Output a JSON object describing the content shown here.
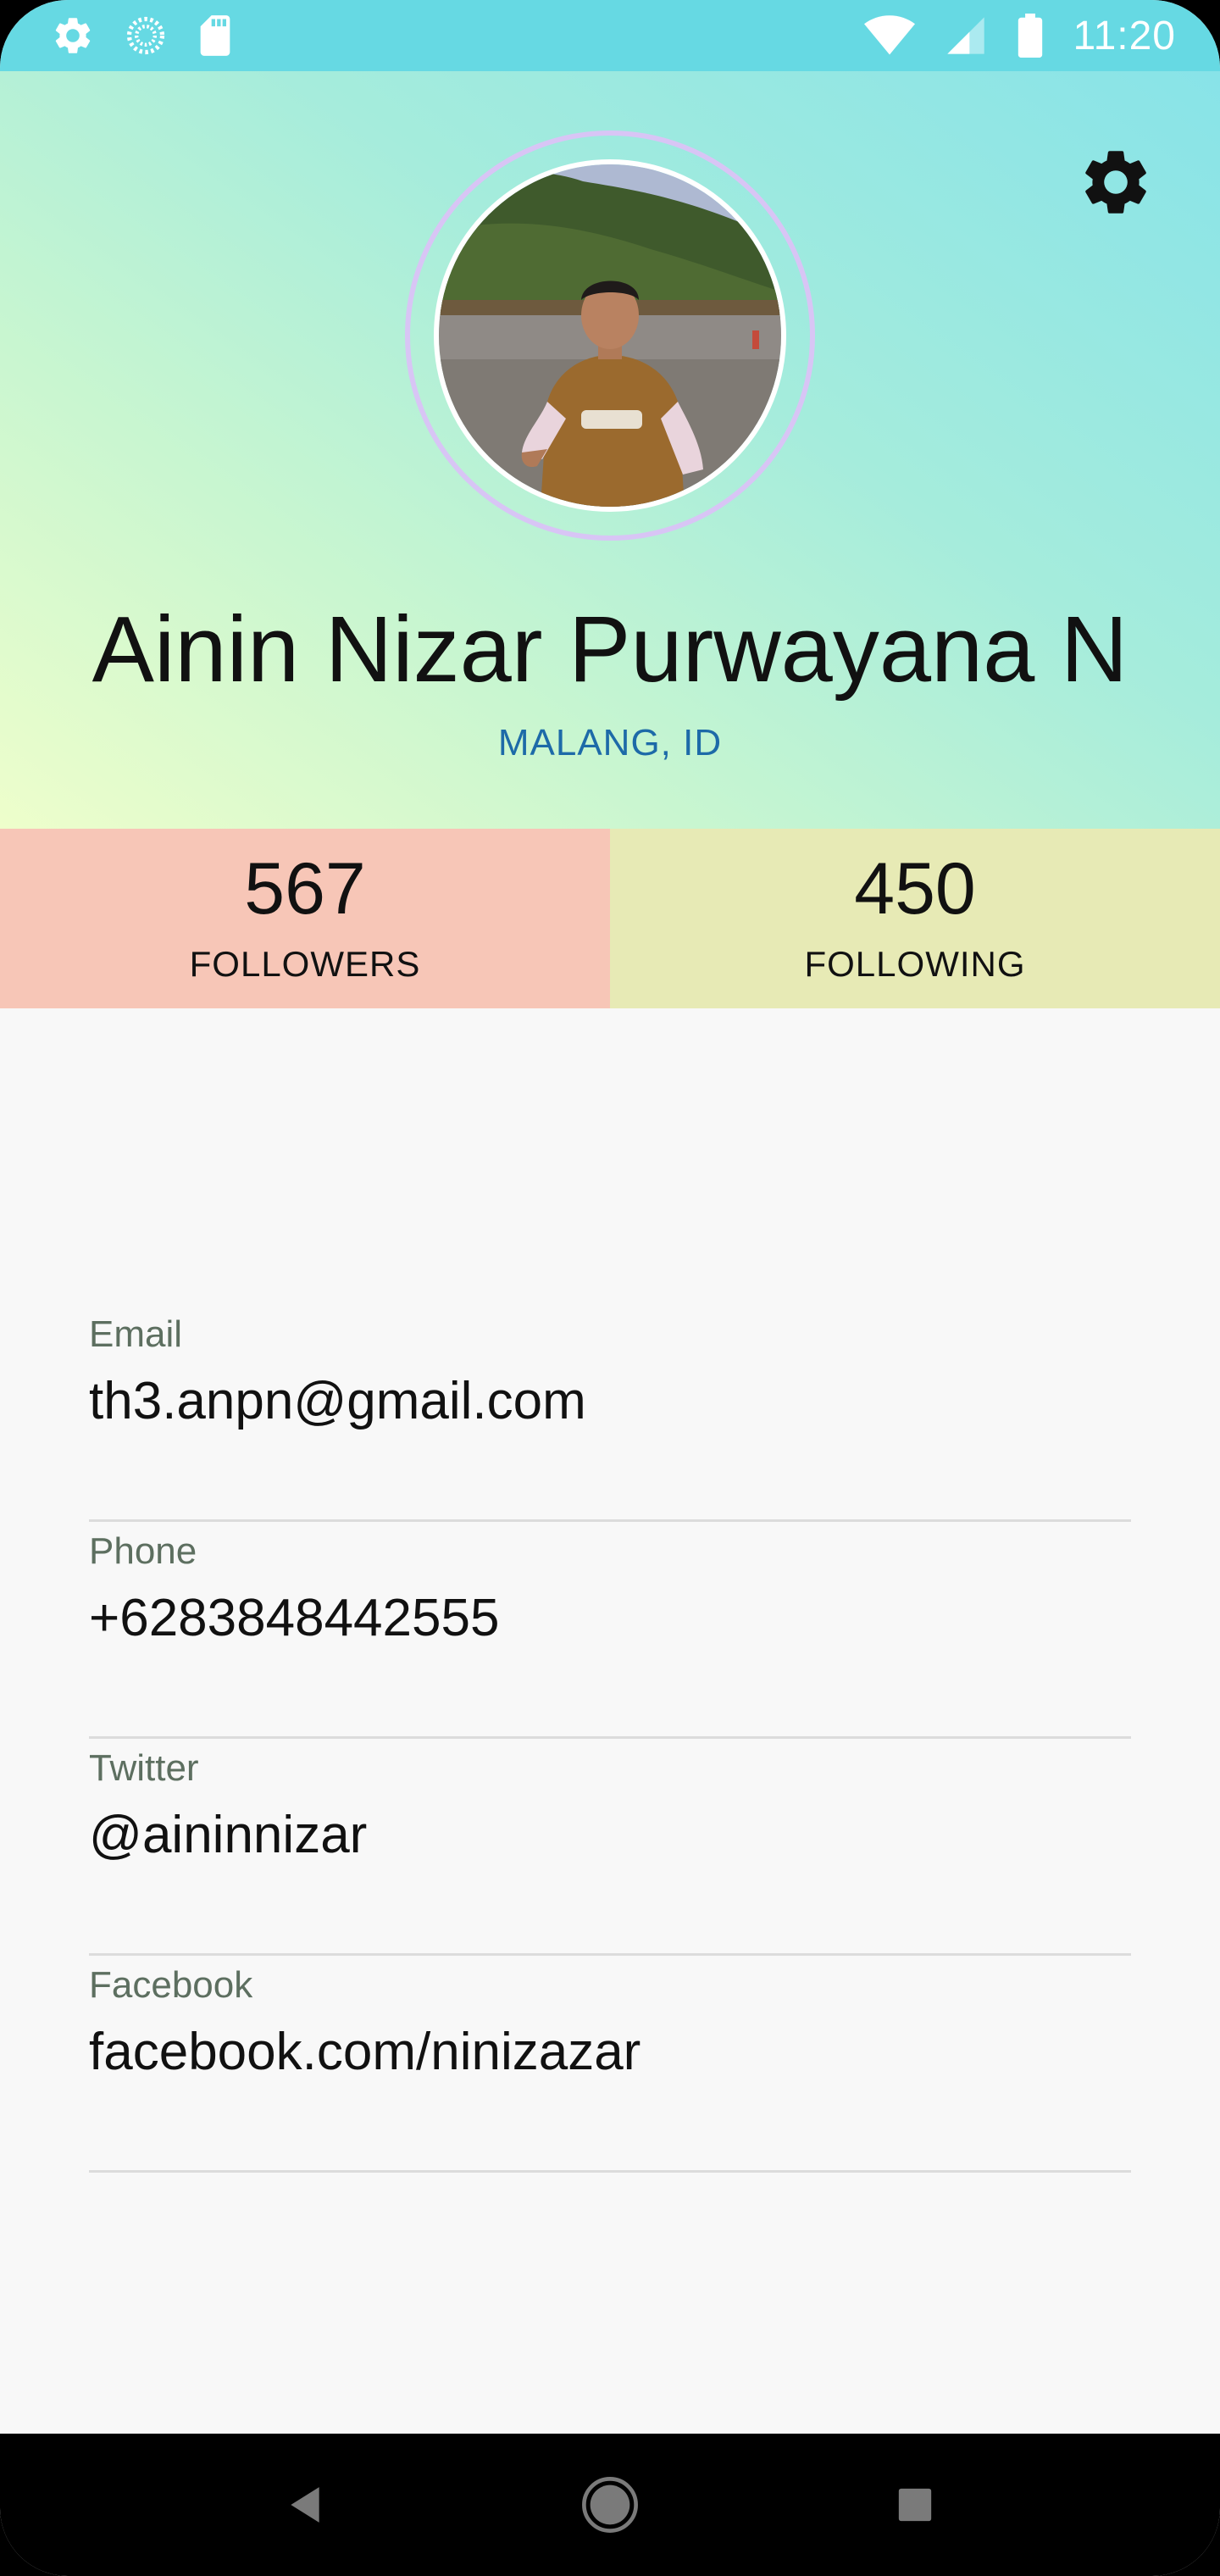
{
  "status_bar": {
    "time": "11:20",
    "left_icons": [
      "settings-icon",
      "sync-icon",
      "sd-card-icon"
    ],
    "right_icons": [
      "wifi-icon",
      "signal-icon",
      "battery-icon"
    ],
    "background": "#66d9e3"
  },
  "header": {
    "settings_icon": "gear-icon",
    "name": "Ainin Nizar Purwayana N",
    "location": "MALANG, ID",
    "location_color": "#1d6aa8"
  },
  "stats": {
    "followers": {
      "count": "567",
      "label": "FOLLOWERS",
      "color": "#f7c6b7"
    },
    "following": {
      "count": "450",
      "label": "FOLLOWING",
      "color": "#e7eab5"
    }
  },
  "details": [
    {
      "label": "Email",
      "value": "th3.anpn@gmail.com"
    },
    {
      "label": "Phone",
      "value": "+6283848442555"
    },
    {
      "label": "Twitter",
      "value": "@aininnizar"
    },
    {
      "label": "Facebook",
      "value": "facebook.com/ninizazar"
    }
  ],
  "nav_bar": {
    "buttons": [
      "back-icon",
      "home-icon",
      "recents-icon"
    ]
  }
}
